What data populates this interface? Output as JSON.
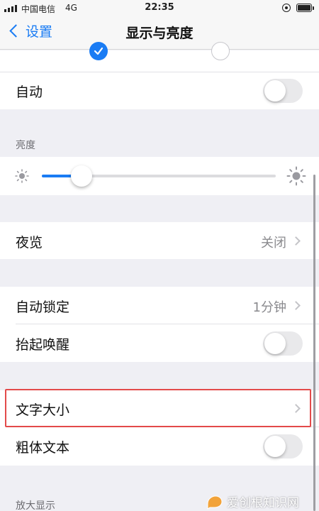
{
  "status_bar": {
    "carrier": "中国电信",
    "network": "4G",
    "time": "22:35"
  },
  "nav": {
    "back_label": "设置",
    "title": "显示与亮度"
  },
  "appearance": {
    "auto_label": "自动",
    "auto_enabled": false
  },
  "brightness": {
    "header": "亮度",
    "level": 0.17
  },
  "night_shift": {
    "label": "夜览",
    "value": "关闭"
  },
  "lock": {
    "auto_lock_label": "自动锁定",
    "auto_lock_value": "1分钟",
    "raise_to_wake_label": "抬起唤醒",
    "raise_to_wake_enabled": false
  },
  "text": {
    "text_size_label": "文字大小",
    "bold_text_label": "粗体文本",
    "bold_text_enabled": false
  },
  "zoom": {
    "header": "放大显示"
  },
  "watermark": {
    "text": "爱创根知识网"
  },
  "colors": {
    "accent": "#1a7cf4",
    "highlight": "#e34a4a",
    "background": "#efeff4"
  },
  "icons": [
    "signal-icon",
    "screen-rotation-lock-icon",
    "battery-icon",
    "back-chevron-icon",
    "checkmark-icon",
    "sun-small-icon",
    "sun-large-icon",
    "chevron-right-icon"
  ]
}
